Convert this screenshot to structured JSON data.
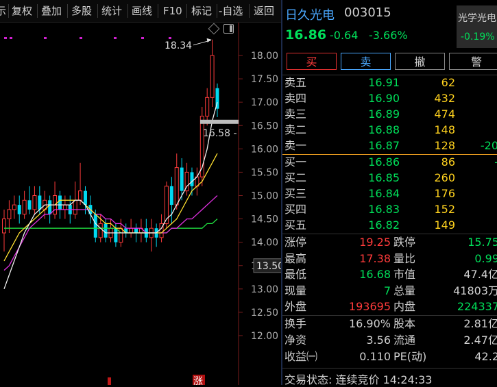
{
  "toolbar": {
    "items": [
      "示",
      "复权",
      "叠加",
      "多股",
      "统计",
      "画线",
      "F10",
      "标记",
      "-自选",
      "返回"
    ]
  },
  "chart": {
    "y_ticks": [
      "18.00",
      "17.50",
      "17.00",
      "16.50",
      "16.00",
      "15.50",
      "15.00",
      "14.50",
      "14.00",
      "13.50",
      "13.00",
      "12.50",
      "12.00"
    ],
    "high_label": "18.34",
    "last_label": "16.58 -",
    "price_tag": "13.50",
    "bottom_marks": [
      "涨"
    ]
  },
  "chart_data": {
    "type": "candlestick",
    "ylim": [
      11.6,
      18.5
    ],
    "candles": [
      {
        "o": 14.2,
        "c": 14.5,
        "h": 14.7,
        "l": 13.8
      },
      {
        "o": 14.5,
        "c": 14.7,
        "h": 14.9,
        "l": 14.2
      },
      {
        "o": 14.7,
        "c": 14.8,
        "h": 15.0,
        "l": 14.5
      },
      {
        "o": 14.8,
        "c": 14.6,
        "h": 15.0,
        "l": 14.4
      },
      {
        "o": 14.6,
        "c": 14.9,
        "h": 15.1,
        "l": 14.5
      },
      {
        "o": 14.9,
        "c": 14.7,
        "h": 15.2,
        "l": 14.6
      },
      {
        "o": 14.7,
        "c": 15.0,
        "h": 15.2,
        "l": 14.6
      },
      {
        "o": 15.0,
        "c": 14.7,
        "h": 15.2,
        "l": 14.6
      },
      {
        "o": 14.7,
        "c": 14.9,
        "h": 15.1,
        "l": 14.5
      },
      {
        "o": 14.9,
        "c": 14.6,
        "h": 15.0,
        "l": 14.4
      },
      {
        "o": 14.6,
        "c": 15.0,
        "h": 15.3,
        "l": 14.5
      },
      {
        "o": 15.0,
        "c": 14.7,
        "h": 15.1,
        "l": 14.5
      },
      {
        "o": 14.7,
        "c": 14.8,
        "h": 15.0,
        "l": 14.5
      },
      {
        "o": 14.8,
        "c": 14.6,
        "h": 15.0,
        "l": 14.4
      },
      {
        "o": 14.6,
        "c": 14.9,
        "h": 15.3,
        "l": 14.5
      },
      {
        "o": 14.9,
        "c": 15.1,
        "h": 15.7,
        "l": 14.8
      },
      {
        "o": 15.1,
        "c": 14.8,
        "h": 15.2,
        "l": 14.6
      },
      {
        "o": 14.8,
        "c": 14.6,
        "h": 15.0,
        "l": 14.4
      },
      {
        "o": 14.6,
        "c": 14.1,
        "h": 14.7,
        "l": 14.0
      },
      {
        "o": 14.1,
        "c": 14.4,
        "h": 14.6,
        "l": 14.0
      },
      {
        "o": 14.4,
        "c": 14.1,
        "h": 14.5,
        "l": 14.0
      },
      {
        "o": 14.1,
        "c": 14.3,
        "h": 14.5,
        "l": 14.0
      },
      {
        "o": 14.3,
        "c": 14.0,
        "h": 14.4,
        "l": 13.9
      },
      {
        "o": 14.0,
        "c": 14.3,
        "h": 14.5,
        "l": 13.9
      },
      {
        "o": 14.3,
        "c": 14.2,
        "h": 14.4,
        "l": 14.1
      },
      {
        "o": 14.2,
        "c": 14.3,
        "h": 14.5,
        "l": 14.1
      },
      {
        "o": 14.3,
        "c": 14.2,
        "h": 14.4,
        "l": 14.0
      },
      {
        "o": 14.2,
        "c": 14.3,
        "h": 14.5,
        "l": 14.0
      },
      {
        "o": 14.3,
        "c": 14.1,
        "h": 14.5,
        "l": 14.0
      },
      {
        "o": 14.1,
        "c": 14.3,
        "h": 14.5,
        "l": 13.8
      },
      {
        "o": 14.3,
        "c": 14.1,
        "h": 14.4,
        "l": 13.9
      },
      {
        "o": 14.1,
        "c": 14.4,
        "h": 14.6,
        "l": 14.0
      },
      {
        "o": 14.4,
        "c": 15.2,
        "h": 15.3,
        "l": 14.3
      },
      {
        "o": 15.2,
        "c": 14.8,
        "h": 15.4,
        "l": 14.4
      },
      {
        "o": 14.8,
        "c": 15.6,
        "h": 15.9,
        "l": 14.7
      },
      {
        "o": 15.6,
        "c": 15.1,
        "h": 15.8,
        "l": 14.9
      },
      {
        "o": 15.1,
        "c": 15.5,
        "h": 15.7,
        "l": 15.0
      },
      {
        "o": 15.5,
        "c": 15.2,
        "h": 15.6,
        "l": 15.0
      },
      {
        "o": 15.2,
        "c": 15.4,
        "h": 15.6,
        "l": 15.0
      },
      {
        "o": 15.4,
        "c": 16.7,
        "h": 16.9,
        "l": 15.2
      },
      {
        "o": 16.7,
        "c": 17.1,
        "h": 17.3,
        "l": 16.5
      },
      {
        "o": 17.1,
        "c": 18.0,
        "h": 18.34,
        "l": 16.9
      },
      {
        "o": 17.3,
        "c": 16.86,
        "h": 17.4,
        "l": 16.68
      }
    ],
    "ma_white": [
      13.0,
      13.3,
      13.6,
      13.9,
      14.2,
      14.4,
      14.6,
      14.7,
      14.8,
      14.8,
      14.8,
      14.8,
      14.8,
      14.8,
      14.9,
      14.9,
      14.8,
      14.6,
      14.4,
      14.3,
      14.2,
      14.2,
      14.2,
      14.2,
      14.2,
      14.2,
      14.2,
      14.2,
      14.2,
      14.2,
      14.2,
      14.3,
      14.5,
      14.6,
      14.8,
      15.0,
      15.2,
      15.3,
      15.4,
      15.6,
      16.0,
      16.6,
      17.0
    ],
    "ma_yellow": [
      13.6,
      13.8,
      14.0,
      14.2,
      14.3,
      14.4,
      14.5,
      14.6,
      14.7,
      14.8,
      14.8,
      14.9,
      14.9,
      14.9,
      14.9,
      14.9,
      14.8,
      14.7,
      14.6,
      14.5,
      14.4,
      14.4,
      14.3,
      14.3,
      14.2,
      14.2,
      14.2,
      14.2,
      14.2,
      14.2,
      14.2,
      14.2,
      14.3,
      14.4,
      14.5,
      14.7,
      14.9,
      15.1,
      15.2,
      15.3,
      15.5,
      15.7,
      15.9
    ],
    "ma_magenta": [
      13.4,
      13.5,
      13.7,
      13.9,
      14.1,
      14.3,
      14.4,
      14.5,
      14.6,
      14.6,
      14.7,
      14.7,
      14.7,
      14.7,
      14.7,
      14.7,
      14.7,
      14.7,
      14.6,
      14.6,
      14.5,
      14.5,
      14.4,
      14.4,
      14.3,
      14.3,
      14.3,
      14.3,
      14.2,
      14.2,
      14.2,
      14.2,
      14.2,
      14.3,
      14.3,
      14.4,
      14.5,
      14.5,
      14.6,
      14.7,
      14.8,
      14.9,
      15.0
    ],
    "ma_green": [
      14.3,
      14.3,
      14.3,
      14.3,
      14.3,
      14.3,
      14.3,
      14.3,
      14.3,
      14.3,
      14.3,
      14.3,
      14.3,
      14.3,
      14.3,
      14.3,
      14.3,
      14.3,
      14.3,
      14.3,
      14.3,
      14.3,
      14.3,
      14.2,
      14.2,
      14.2,
      14.2,
      14.2,
      14.2,
      14.2,
      14.2,
      14.2,
      14.2,
      14.3,
      14.3,
      14.3,
      14.3,
      14.3,
      14.3,
      14.3,
      14.4,
      14.4,
      14.5
    ]
  },
  "quote": {
    "name": "日久光电",
    "code": "003015",
    "price": "16.86",
    "change": "-0.64",
    "change_pct": "-3.66%",
    "sector_name": "光学光电",
    "sector_pct": "-0.19%"
  },
  "buttons": {
    "buy": "买",
    "sell": "卖",
    "cancel": "撤",
    "alert": "警"
  },
  "colors": {
    "up": "#ff3b3b",
    "down": "#00e05a",
    "volume": "#ffd21e",
    "label": "#d0d0d0",
    "accent": "#4aa8ff",
    "divider_line": "#f0a020"
  },
  "order_book": {
    "asks": [
      {
        "label": "卖五",
        "price": "16.91",
        "vol": "62",
        "ext": ""
      },
      {
        "label": "卖四",
        "price": "16.90",
        "vol": "432",
        "ext": ""
      },
      {
        "label": "卖三",
        "price": "16.89",
        "vol": "474",
        "ext": ""
      },
      {
        "label": "卖二",
        "price": "16.88",
        "vol": "148",
        "ext": ""
      },
      {
        "label": "卖一",
        "price": "16.87",
        "vol": "128",
        "ext": "-20"
      }
    ],
    "bids": [
      {
        "label": "买一",
        "price": "16.86",
        "vol": "86",
        "ext": "-"
      },
      {
        "label": "买二",
        "price": "16.85",
        "vol": "260",
        "ext": ""
      },
      {
        "label": "买三",
        "price": "16.84",
        "vol": "176",
        "ext": ""
      },
      {
        "label": "买四",
        "price": "16.83",
        "vol": "152",
        "ext": ""
      },
      {
        "label": "买五",
        "price": "16.82",
        "vol": "149",
        "ext": ""
      }
    ]
  },
  "stats": [
    {
      "l1": "涨停",
      "v1": "19.25",
      "c1": "red",
      "l2": "跌停",
      "v2": "15.75",
      "c2": "grn"
    },
    {
      "l1": "最高",
      "v1": "17.38",
      "c1": "red",
      "l2": "量比",
      "v2": "0.99",
      "c2": "grn"
    },
    {
      "l1": "最低",
      "v1": "16.68",
      "c1": "grn",
      "l2": "市值",
      "v2": "47.4亿",
      "c2": "wht"
    },
    {
      "l1": "现量",
      "v1": "7",
      "c1": "grn",
      "l2": "总量",
      "v2": "41803万",
      "c2": "wht"
    },
    {
      "l1": "外盘",
      "v1": "193695",
      "c1": "red",
      "l2": "内盘",
      "v2": "224337",
      "c2": "grn"
    },
    {
      "l1": "换手",
      "v1": "16.90%",
      "c1": "wht",
      "l2": "股本",
      "v2": "2.81亿",
      "c2": "wht"
    },
    {
      "l1": "净资",
      "v1": "3.56",
      "c1": "wht",
      "l2": "流通",
      "v2": "2.47亿",
      "c2": "wht"
    },
    {
      "l1": "收益㈠",
      "v1": "0.110",
      "c1": "wht",
      "l2": "PE(动)",
      "v2": "42.2",
      "c2": "wht"
    }
  ],
  "status_bar": {
    "text": "交易状态: 连续竞价 14:24:33"
  }
}
